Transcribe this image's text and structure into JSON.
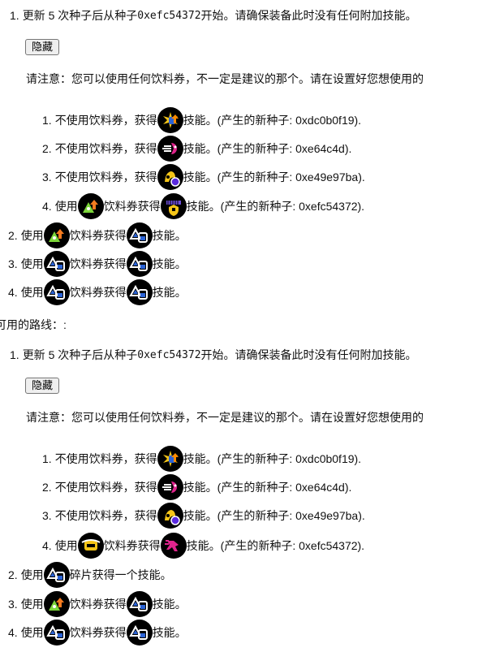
{
  "sections": [
    {
      "step1": {
        "num": "1.",
        "text_a": "更新 5 次种子后从种子 ",
        "seed": "0xefc54372",
        "text_b": " 开始。请确保装备此时没有任何附加技能。"
      },
      "hide_label": "隐藏",
      "note": "请注意：您可以使用任何饮料券，不一定是建议的那个。请在设置好您想使用的",
      "sub": [
        {
          "num": "1.",
          "pre": "不使用饮料券，获得",
          "icon": "skill-ink-recovery-icon",
          "post": "技能。(产生的新种子: 0xdc0b0f19)."
        },
        {
          "num": "2.",
          "pre": "不使用饮料券，获得",
          "icon": "skill-swim-speed-icon",
          "post": "技能。(产生的新种子: 0xe64c4d)."
        },
        {
          "num": "3.",
          "pre": "不使用饮料券，获得",
          "icon": "skill-special-charge-icon",
          "post": "技能。(产生的新种子: 0xe49e97ba)."
        },
        {
          "num": "4.",
          "pre": "使用",
          "ticket": "ticket-sub-saver-icon",
          "mid": "饮料券获得",
          "icon": "skill-sub-power-icon",
          "post": "技能。(产生的新种子: 0xefc54372)."
        }
      ],
      "steps": [
        {
          "num": "2.",
          "pre": "使用",
          "ticket": "ticket-ink-saver-icon",
          "mid": "饮料券获得",
          "icon": "skill-main-saver-icon",
          "post": "技能。"
        },
        {
          "num": "3.",
          "pre": "使用",
          "ticket": "ticket-main-saver-icon",
          "mid": "饮料券获得",
          "icon": "skill-main-saver-icon",
          "post": "技能。"
        },
        {
          "num": "4.",
          "pre": "使用",
          "ticket": "ticket-main-saver-icon",
          "mid": "饮料券获得",
          "icon": "skill-main-saver-icon",
          "post": "技能。"
        }
      ]
    },
    {
      "heading": "可用的路线：:",
      "step1": {
        "num": "1.",
        "text_a": "更新 5 次种子后从种子 ",
        "seed": "0xefc54372",
        "text_b": " 开始。请确保装备此时没有任何附加技能。"
      },
      "hide_label": "隐藏",
      "note": "请注意：您可以使用任何饮料券，不一定是建议的那个。请在设置好您想使用的",
      "sub": [
        {
          "num": "1.",
          "pre": "不使用饮料券，获得",
          "icon": "skill-ink-recovery-icon",
          "post": "技能。(产生的新种子: 0xdc0b0f19)."
        },
        {
          "num": "2.",
          "pre": "不使用饮料券，获得",
          "icon": "skill-swim-speed-icon",
          "post": "技能。(产生的新种子: 0xe64c4d)."
        },
        {
          "num": "3.",
          "pre": "不使用饮料券，获得",
          "icon": "skill-special-charge-icon",
          "post": "技能。(产生的新种子: 0xe49e97ba)."
        },
        {
          "num": "4.",
          "pre": "使用",
          "ticket": "ticket-run-speed-icon",
          "mid": "饮料券获得",
          "icon": "skill-run-speed-icon",
          "post": "技能。(产生的新种子: 0xefc54372)."
        }
      ],
      "steps": [
        {
          "num": "2.",
          "pre": "使用",
          "ticket": "ticket-main-saver-icon",
          "mid": "碎片获得一个技能。",
          "icon": "",
          "post": ""
        },
        {
          "num": "3.",
          "pre": "使用",
          "ticket": "ticket-ink-saver-icon",
          "mid": "饮料券获得",
          "icon": "skill-main-saver-icon",
          "post": "技能。"
        },
        {
          "num": "4.",
          "pre": "使用",
          "ticket": "ticket-main-saver-icon",
          "mid": "饮料券获得",
          "icon": "skill-main-saver-icon",
          "post": "技能。"
        }
      ]
    }
  ]
}
